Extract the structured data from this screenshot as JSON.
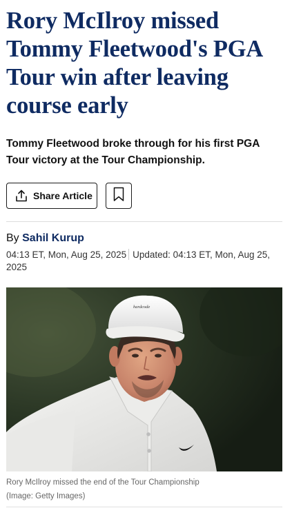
{
  "article": {
    "headline": "Rory McIlroy missed Tommy Fleetwood's PGA Tour win after leaving course early",
    "subheadline": "Tommy Fleetwood broke through for his first PGA Tour victory at the Tour Championship.",
    "actions": {
      "share_label": "Share Article",
      "share_icon": "share-upload-icon",
      "bookmark_icon": "bookmark-icon"
    },
    "byline": {
      "prefix": "By",
      "author": "Sahil Kurup"
    },
    "published": "04:13 ET, Mon, Aug 25, 2025",
    "updated": "Updated: 04:13 ET, Mon, Aug 25, 2025",
    "image": {
      "cap_text": "hardcode",
      "caption": "Rory McIlroy missed the end of the Tour Championship",
      "credit": "(Image: Getty Images)"
    }
  },
  "colors": {
    "headline": "#0f2b62",
    "author": "#0f2b62",
    "text": "#111111",
    "meta": "#333333",
    "caption": "#666666"
  }
}
